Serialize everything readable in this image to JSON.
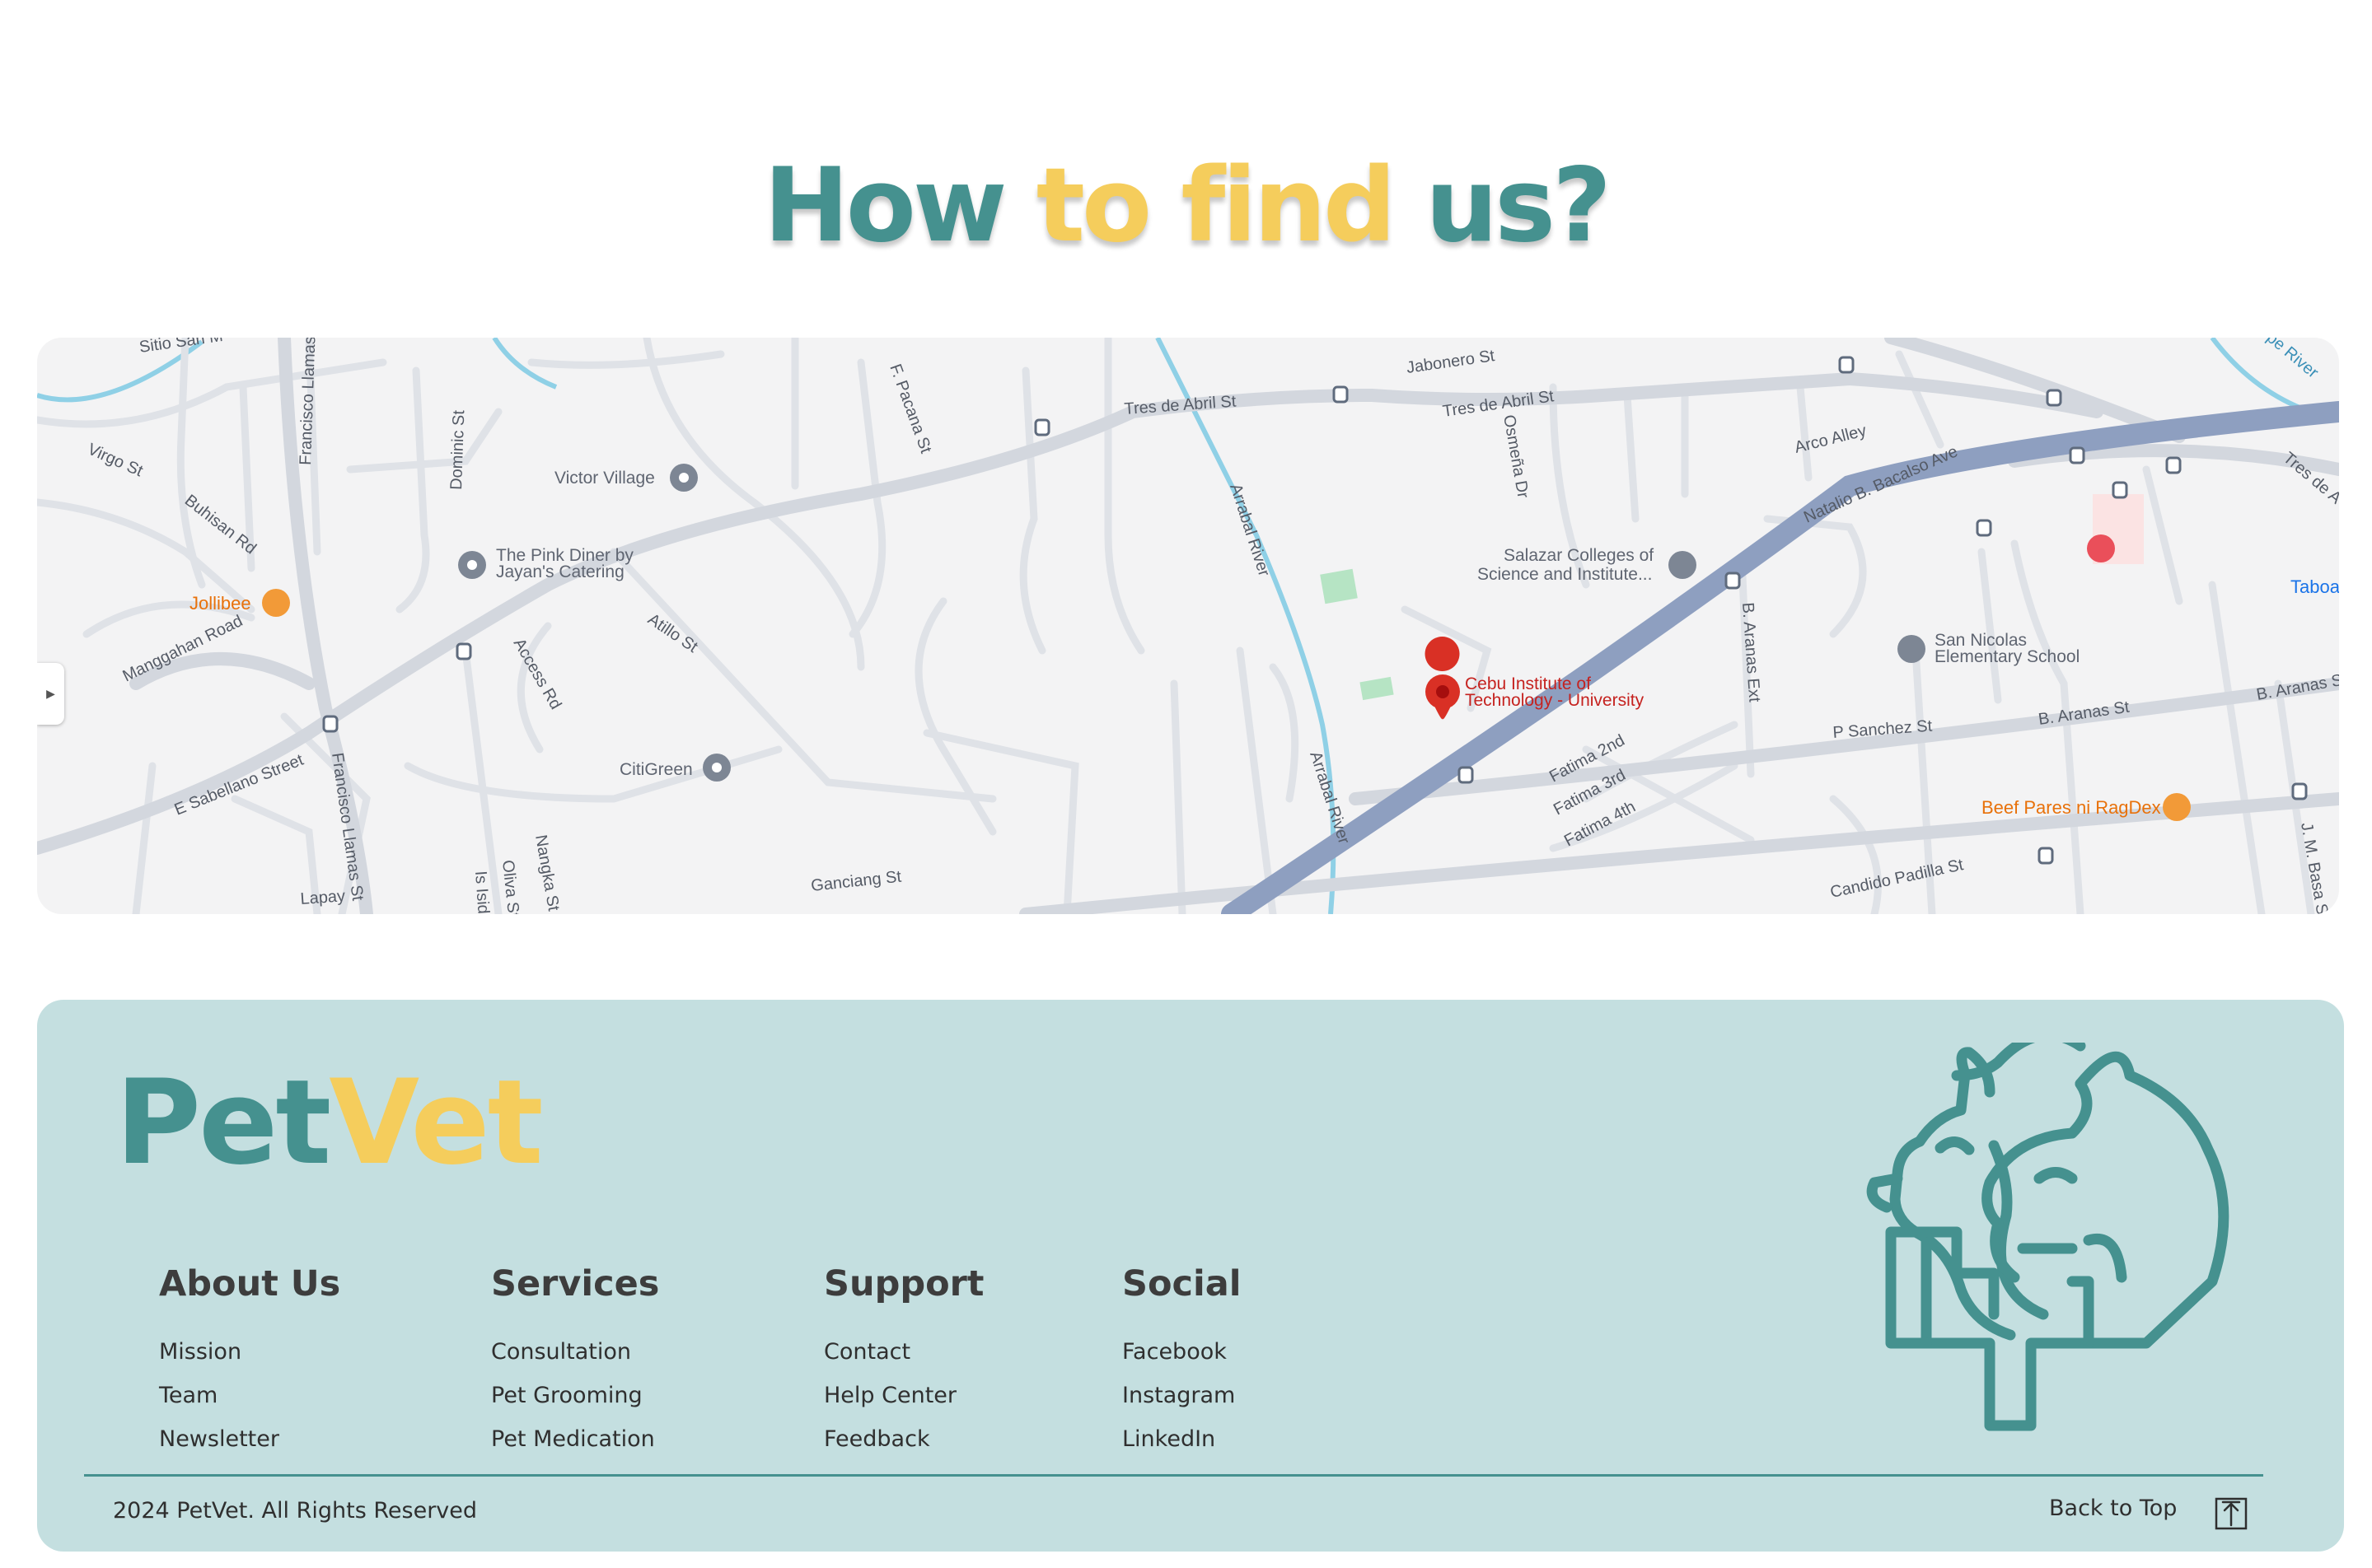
{
  "heading": {
    "part1": "How",
    "part2": "to find",
    "part3": "us?"
  },
  "colors": {
    "teal": "#45918f",
    "gold": "#f5cd5c",
    "footer_bg": "#c4dfe0",
    "text_dark": "#2f2f2f"
  },
  "map": {
    "places": {
      "victor_village": "Victor Village",
      "pink_diner_1": "The Pink Diner by",
      "pink_diner_2": "Jayan's Catering",
      "jollibee": "Jollibee",
      "citigreen": "CitiGreen",
      "salazar_1": "Salazar Colleges of",
      "salazar_2": "Science and Institute...",
      "cit_1": "Cebu Institute of",
      "cit_2": "Technology - University",
      "san_nicolas_1": "San Nicolas",
      "san_nicolas_2": "Elementary School",
      "beef_pares": "Beef Pares ni RagDex",
      "taboan": "Taboa"
    },
    "roads": {
      "sitio_san": "Sitio San M",
      "francisco_llamas_top": "Francisco Llamas",
      "f_pacana": "F. Pacana St",
      "tres_de_abril_1": "Tres de Abril St",
      "tres_de_abril_2": "Tres de Abril St",
      "jabonero": "Jabonero St",
      "virgo": "Virgo St",
      "buhisan": "Buhisan Rd",
      "dominic": "Dominic St",
      "manggahan": "Manggahan Road",
      "atillo": "Atillo St",
      "access_rd": "Access Rd",
      "arrabal_1": "Arrabal River",
      "arrabal_2": "Arrabal River",
      "osmena": "Osmeña Dr",
      "arco_alley": "Arco Alley",
      "natalio": "Natalio B. Bacalso Ave",
      "tres_de_a_right": "Tres de A",
      "e_sabellano": "E Sabellano Street",
      "francisco_llamas_bottom": "Francisco Llamas St",
      "lapay": "Lapay",
      "oliva": "Oliva St",
      "nangka": "Nangka St",
      "isidro": "Is Isidro",
      "ganciang": "Ganciang St",
      "b_aranas_ext": "B. Aranas Ext",
      "p_sanchez": "P Sanchez St",
      "b_aranas": "B. Aranas St",
      "b_aranas_right": "B. Aranas S",
      "fatima_2nd": "Fatima 2nd",
      "fatima_3rd": "Fatima 3rd",
      "fatima_4th": "Fatima 4th",
      "candido": "Candido Padilla St",
      "j_m_basa": "J. M. Basa S",
      "river_top_right": "pe River"
    }
  },
  "footer": {
    "brand_part1": "Pet",
    "brand_part2": "Vet",
    "columns": [
      {
        "title": "About Us",
        "links": [
          "Mission",
          "Team",
          "Newsletter"
        ]
      },
      {
        "title": "Services",
        "links": [
          "Consultation",
          "Pet Grooming",
          "Pet Medication"
        ]
      },
      {
        "title": "Support",
        "links": [
          "Contact",
          "Help Center",
          "Feedback"
        ]
      },
      {
        "title": "Social",
        "links": [
          "Facebook",
          "Instagram",
          "LinkedIn"
        ]
      }
    ],
    "copyright": "2024 PetVet. All Rights Reserved",
    "back_to_top": "Back to Top",
    "icons": {
      "back_to_top": "arrow-up-box-icon",
      "logo": "dog-cat-cross-logo-icon"
    }
  }
}
